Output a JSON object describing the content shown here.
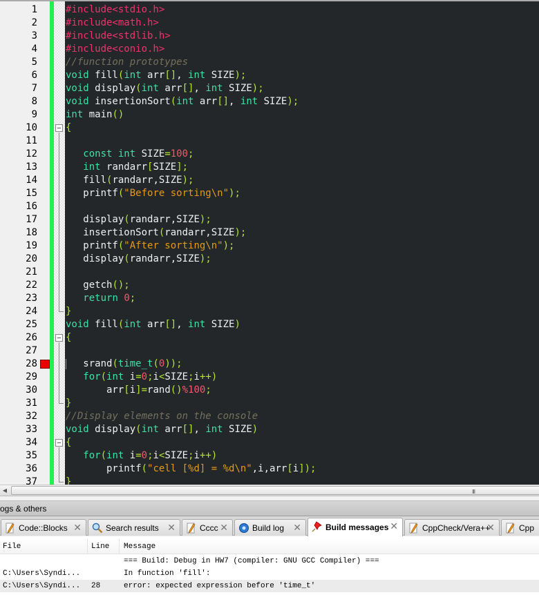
{
  "editor": {
    "breakpoint_line": 28,
    "lines": [
      {
        "n": "1",
        "tokens": [
          [
            "pp",
            "#include<stdio.h>"
          ]
        ]
      },
      {
        "n": "2",
        "tokens": [
          [
            "pp",
            "#include<math.h>"
          ]
        ]
      },
      {
        "n": "3",
        "tokens": [
          [
            "pp",
            "#include<stdlib.h>"
          ]
        ]
      },
      {
        "n": "4",
        "tokens": [
          [
            "pp",
            "#include<conio.h>"
          ]
        ]
      },
      {
        "n": "5",
        "tokens": [
          [
            "cm",
            "//function prototypes"
          ]
        ]
      },
      {
        "n": "6",
        "tokens": [
          [
            "kw",
            "void"
          ],
          [
            "id",
            " fill"
          ],
          [
            "pn",
            "("
          ],
          [
            "kw",
            "int"
          ],
          [
            "id",
            " arr"
          ],
          [
            "pn",
            "[]"
          ],
          [
            "id",
            ", "
          ],
          [
            "kw",
            "int"
          ],
          [
            "id",
            " SIZE"
          ],
          [
            "pn",
            ");"
          ]
        ]
      },
      {
        "n": "7",
        "tokens": [
          [
            "kw",
            "void"
          ],
          [
            "id",
            " display"
          ],
          [
            "pn",
            "("
          ],
          [
            "kw",
            "int"
          ],
          [
            "id",
            " arr"
          ],
          [
            "pn",
            "[]"
          ],
          [
            "id",
            ", "
          ],
          [
            "kw",
            "int"
          ],
          [
            "id",
            " SIZE"
          ],
          [
            "pn",
            ");"
          ]
        ]
      },
      {
        "n": "8",
        "tokens": [
          [
            "kw",
            "void"
          ],
          [
            "id",
            " insertionSort"
          ],
          [
            "pn",
            "("
          ],
          [
            "kw",
            "int"
          ],
          [
            "id",
            " arr"
          ],
          [
            "pn",
            "[]"
          ],
          [
            "id",
            ", "
          ],
          [
            "kw",
            "int"
          ],
          [
            "id",
            " SIZE"
          ],
          [
            "pn",
            ");"
          ]
        ]
      },
      {
        "n": "9",
        "tokens": [
          [
            "kw",
            "int"
          ],
          [
            "id",
            " main"
          ],
          [
            "pn",
            "()"
          ]
        ]
      },
      {
        "n": "10",
        "tokens": [
          [
            "pn",
            "{"
          ]
        ]
      },
      {
        "n": "11",
        "tokens": []
      },
      {
        "n": "12",
        "tokens": [
          [
            "id",
            "   "
          ],
          [
            "kw",
            "const int"
          ],
          [
            "id",
            " SIZE"
          ],
          [
            "pn",
            "="
          ],
          [
            "nm",
            "100"
          ],
          [
            "pn",
            ";"
          ]
        ]
      },
      {
        "n": "13",
        "tokens": [
          [
            "id",
            "   "
          ],
          [
            "kw",
            "int"
          ],
          [
            "id",
            " randarr"
          ],
          [
            "pn",
            "["
          ],
          [
            "id",
            "SIZE"
          ],
          [
            "pn",
            "];"
          ]
        ]
      },
      {
        "n": "14",
        "tokens": [
          [
            "id",
            "   fill"
          ],
          [
            "pn",
            "("
          ],
          [
            "id",
            "randarr,SIZE"
          ],
          [
            "pn",
            ");"
          ]
        ]
      },
      {
        "n": "15",
        "tokens": [
          [
            "id",
            "   printf"
          ],
          [
            "pn",
            "("
          ],
          [
            "st",
            "\"Before sorting\\n\""
          ],
          [
            "pn",
            ");"
          ]
        ]
      },
      {
        "n": "16",
        "tokens": []
      },
      {
        "n": "17",
        "tokens": [
          [
            "id",
            "   display"
          ],
          [
            "pn",
            "("
          ],
          [
            "id",
            "randarr,SIZE"
          ],
          [
            "pn",
            ");"
          ]
        ]
      },
      {
        "n": "18",
        "tokens": [
          [
            "id",
            "   insertionSort"
          ],
          [
            "pn",
            "("
          ],
          [
            "id",
            "randarr,SIZE"
          ],
          [
            "pn",
            ");"
          ]
        ]
      },
      {
        "n": "19",
        "tokens": [
          [
            "id",
            "   printf"
          ],
          [
            "pn",
            "("
          ],
          [
            "st",
            "\"After sorting\\n\""
          ],
          [
            "pn",
            ");"
          ]
        ]
      },
      {
        "n": "20",
        "tokens": [
          [
            "id",
            "   display"
          ],
          [
            "pn",
            "("
          ],
          [
            "id",
            "randarr,SIZE"
          ],
          [
            "pn",
            ");"
          ]
        ]
      },
      {
        "n": "21",
        "tokens": []
      },
      {
        "n": "22",
        "tokens": [
          [
            "id",
            "   getch"
          ],
          [
            "pn",
            "();"
          ]
        ]
      },
      {
        "n": "23",
        "tokens": [
          [
            "id",
            "   "
          ],
          [
            "kw",
            "return"
          ],
          [
            "id",
            " "
          ],
          [
            "nm",
            "0"
          ],
          [
            "pn",
            ";"
          ]
        ]
      },
      {
        "n": "24",
        "tokens": [
          [
            "pn",
            "}"
          ]
        ]
      },
      {
        "n": "25",
        "tokens": [
          [
            "kw",
            "void"
          ],
          [
            "id",
            " fill"
          ],
          [
            "pn",
            "("
          ],
          [
            "kw",
            "int"
          ],
          [
            "id",
            " arr"
          ],
          [
            "pn",
            "[]"
          ],
          [
            "id",
            ", "
          ],
          [
            "kw",
            "int"
          ],
          [
            "id",
            " SIZE"
          ],
          [
            "pn",
            ")"
          ]
        ]
      },
      {
        "n": "26",
        "tokens": [
          [
            "pn",
            "{"
          ]
        ]
      },
      {
        "n": "27",
        "tokens": []
      },
      {
        "n": "28",
        "tokens": [
          [
            "id",
            "   srand"
          ],
          [
            "pn",
            "("
          ],
          [
            "kw",
            "time_t"
          ],
          [
            "pn",
            "("
          ],
          [
            "nm",
            "0"
          ],
          [
            "pn",
            "));"
          ]
        ]
      },
      {
        "n": "29",
        "tokens": [
          [
            "id",
            "   "
          ],
          [
            "kw",
            "for"
          ],
          [
            "pn",
            "("
          ],
          [
            "kw",
            "int"
          ],
          [
            "id",
            " i"
          ],
          [
            "pn",
            "="
          ],
          [
            "nm",
            "0"
          ],
          [
            "pn",
            ";"
          ],
          [
            "id",
            "i"
          ],
          [
            "pn",
            "<"
          ],
          [
            "id",
            "SIZE"
          ],
          [
            "pn",
            ";"
          ],
          [
            "id",
            "i"
          ],
          [
            "pn",
            "++)"
          ]
        ]
      },
      {
        "n": "30",
        "tokens": [
          [
            "id",
            "       arr"
          ],
          [
            "pn",
            "["
          ],
          [
            "id",
            "i"
          ],
          [
            "pn",
            "]="
          ],
          [
            "id",
            "rand"
          ],
          [
            "pn",
            "()"
          ],
          [
            "nm",
            "%100"
          ],
          [
            "pn",
            ";"
          ]
        ]
      },
      {
        "n": "31",
        "tokens": [
          [
            "pn",
            "}"
          ]
        ]
      },
      {
        "n": "32",
        "tokens": [
          [
            "cm",
            "//Display elements on the console"
          ]
        ]
      },
      {
        "n": "33",
        "tokens": [
          [
            "kw",
            "void"
          ],
          [
            "id",
            " display"
          ],
          [
            "pn",
            "("
          ],
          [
            "kw",
            "int"
          ],
          [
            "id",
            " arr"
          ],
          [
            "pn",
            "[]"
          ],
          [
            "id",
            ", "
          ],
          [
            "kw",
            "int"
          ],
          [
            "id",
            " SIZE"
          ],
          [
            "pn",
            ")"
          ]
        ]
      },
      {
        "n": "34",
        "tokens": [
          [
            "pn",
            "{"
          ]
        ]
      },
      {
        "n": "35",
        "tokens": [
          [
            "id",
            "   "
          ],
          [
            "kw",
            "for"
          ],
          [
            "pn",
            "("
          ],
          [
            "kw",
            "int"
          ],
          [
            "id",
            " i"
          ],
          [
            "pn",
            "="
          ],
          [
            "nm",
            "0"
          ],
          [
            "pn",
            ";"
          ],
          [
            "id",
            "i"
          ],
          [
            "pn",
            "<"
          ],
          [
            "id",
            "SIZE"
          ],
          [
            "pn",
            ";"
          ],
          [
            "id",
            "i"
          ],
          [
            "pn",
            "++)"
          ]
        ]
      },
      {
        "n": "36",
        "tokens": [
          [
            "id",
            "       printf"
          ],
          [
            "pn",
            "("
          ],
          [
            "st",
            "\"cell [%d] = %d\\n\""
          ],
          [
            "id",
            ",i,arr"
          ],
          [
            "pn",
            "["
          ],
          [
            "id",
            "i"
          ],
          [
            "pn",
            "]);"
          ]
        ]
      },
      {
        "n": "37",
        "tokens": [
          [
            "pn",
            "}"
          ]
        ]
      }
    ]
  },
  "panel": {
    "title": "ogs & others",
    "tabs": [
      {
        "label": "Code::Blocks",
        "icon": "pencil-icon",
        "active": false
      },
      {
        "label": "Search results",
        "icon": "magnifier-icon",
        "active": false
      },
      {
        "label": "Cccc",
        "icon": "pencil-icon",
        "active": false
      },
      {
        "label": "Build log",
        "icon": "gear-icon",
        "active": false
      },
      {
        "label": "Build messages",
        "icon": "pushpin-icon",
        "active": true
      },
      {
        "label": "CppCheck/Vera++",
        "icon": "pencil-icon",
        "active": false
      },
      {
        "label": "Cpp",
        "icon": "pencil-icon",
        "active": false
      }
    ],
    "close_glyph": "✕"
  },
  "messages": {
    "columns": {
      "file": "File",
      "line": "Line",
      "message": "Message"
    },
    "rows": [
      {
        "file": "",
        "line": "",
        "message": "=== Build: Debug in HW7 (compiler: GNU GCC Compiler) ===",
        "selected": false
      },
      {
        "file": "C:\\Users\\Syndi...",
        "line": "",
        "message": "In function 'fill':",
        "selected": false
      },
      {
        "file": "C:\\Users\\Syndi...",
        "line": "28",
        "message": "error: expected expression before 'time_t'",
        "selected": true
      }
    ]
  },
  "scrollbar": {
    "left_arrow": "◀",
    "grip": "III"
  }
}
